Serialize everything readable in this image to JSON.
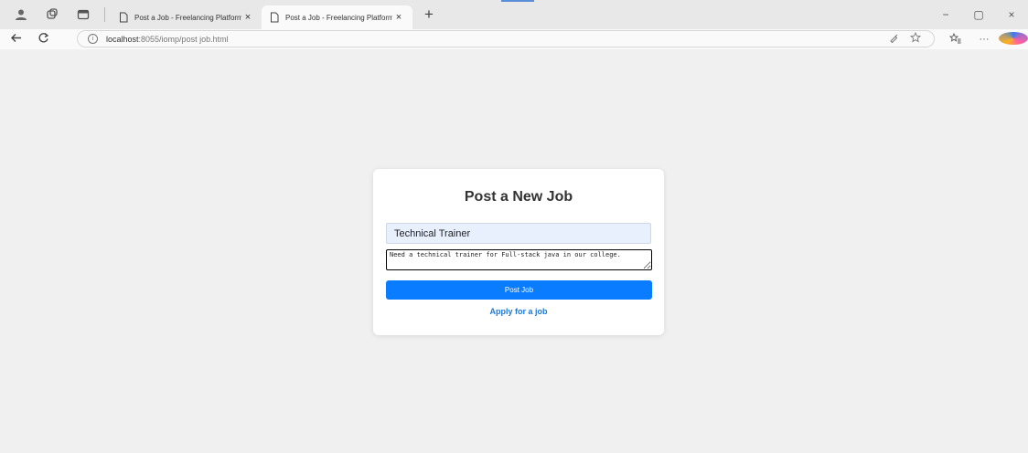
{
  "browser": {
    "tabs": [
      {
        "title": "Post a Job - Freelancing Platform",
        "close": "×"
      },
      {
        "title": "Post a Job - Freelancing Platform",
        "close": "×"
      }
    ],
    "new_tab": "+",
    "window": {
      "minimize": "−",
      "restore": "▢",
      "close": "×"
    },
    "url_host": "localhost",
    "url_path": ":8055/iomp/post job.html",
    "info": "i"
  },
  "page": {
    "heading": "Post a New Job",
    "job_title_value": "Technical Trainer",
    "description_value": "Need a technical trainer for Full-stack java in our college.",
    "post_button_label": "Post Job",
    "apply_link_label": "Apply for a job"
  }
}
